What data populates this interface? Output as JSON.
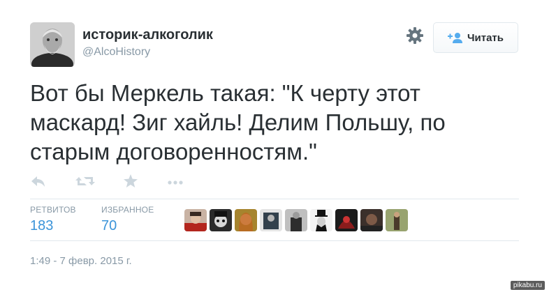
{
  "profile": {
    "display_name": "историк-алкоголик",
    "handle": "@AlcoHistory"
  },
  "header": {
    "settings_icon": "gear-icon",
    "follow_label": "Читать",
    "follow_icon": "follow-user-icon"
  },
  "tweet": {
    "lines": [
      "Вот бы Меркель такая: \"К черту этот",
      "маскард! Зиг хайль! Делим Польшу, по",
      "старым договоренностям.\""
    ],
    "timestamp": "1:49 - 7 февр. 2015 г."
  },
  "actions": [
    {
      "name": "reply",
      "icon": "reply-icon"
    },
    {
      "name": "retweet",
      "icon": "retweet-icon"
    },
    {
      "name": "favorite",
      "icon": "star-icon"
    },
    {
      "name": "more",
      "icon": "more-dots-icon"
    }
  ],
  "stats": {
    "retweets_label": "РЕТВИТОВ",
    "retweets_count": "183",
    "favorites_label": "ИЗБРАННОЕ",
    "favorites_count": "70"
  },
  "colors": {
    "text": "#292f33",
    "muted": "#8899a6",
    "link": "#3b94d9",
    "border": "#e1e8ed"
  },
  "watermark": "pikabu.ru"
}
